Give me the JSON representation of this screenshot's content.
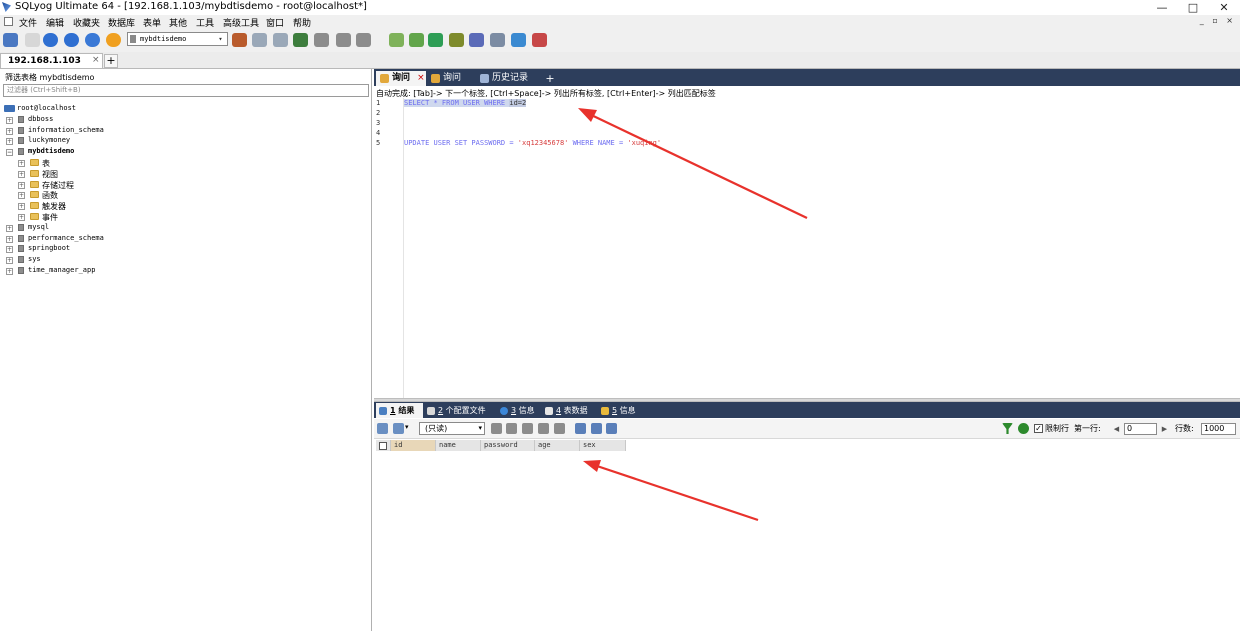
{
  "window": {
    "title": "SQLyog Ultimate 64 - [192.168.1.103/mybdtisdemo - root@localhost*]",
    "controls": [
      "—",
      "□",
      "✕"
    ],
    "mdi_controls": "_ ▫ ×"
  },
  "menu": [
    "文件",
    "编辑",
    "收藏夹",
    "数据库",
    "表单",
    "其他",
    "工具",
    "高级工具",
    "窗口",
    "帮助"
  ],
  "toolbar": {
    "database_select": "mybdtisdemo"
  },
  "connection_tab": {
    "label": "192.168.1.103",
    "close": "×",
    "new": "+"
  },
  "left": {
    "filter_label": "筛选表格 mybdtisdemo",
    "filter_placeholder": "过滤器 (Ctrl+Shift+B)",
    "tree": [
      {
        "label": "root@localhost",
        "level": 0,
        "kind": "server"
      },
      {
        "label": "dbboss",
        "level": 1,
        "kind": "db"
      },
      {
        "label": "information_schema",
        "level": 1,
        "kind": "db"
      },
      {
        "label": "luckymoney",
        "level": 1,
        "kind": "db"
      },
      {
        "label": "mybdtisdemo",
        "level": 1,
        "kind": "db",
        "expanded": true,
        "bold": true
      },
      {
        "label": "表",
        "level": 2,
        "kind": "folder"
      },
      {
        "label": "视图",
        "level": 2,
        "kind": "folder"
      },
      {
        "label": "存储过程",
        "level": 2,
        "kind": "folder"
      },
      {
        "label": "函数",
        "level": 2,
        "kind": "folder"
      },
      {
        "label": "触发器",
        "level": 2,
        "kind": "folder"
      },
      {
        "label": "事件",
        "level": 2,
        "kind": "folder"
      },
      {
        "label": "mysql",
        "level": 1,
        "kind": "db"
      },
      {
        "label": "performance_schema",
        "level": 1,
        "kind": "db"
      },
      {
        "label": "springboot",
        "level": 1,
        "kind": "db"
      },
      {
        "label": "sys",
        "level": 1,
        "kind": "db"
      },
      {
        "label": "time_manager_app",
        "level": 1,
        "kind": "db"
      }
    ]
  },
  "query_tabs": [
    {
      "label": "询问",
      "active": true,
      "close": "×"
    },
    {
      "label": "询问",
      "active": false
    },
    {
      "label": "历史记录",
      "active": false
    }
  ],
  "query_tab_add": "+",
  "autocomplete_hint": "自动完成: [Tab]-> 下一个标签, [Ctrl+Space]-> 列出所有标签, [Ctrl+Enter]-> 列出匹配标签",
  "editor": {
    "line_numbers": [
      "1",
      "2",
      "3",
      "4",
      "5"
    ],
    "line1": {
      "pre": "SELECT * FROM USER WHERE ",
      "sel": "id=2"
    },
    "line5": {
      "kw": "UPDATE USER SET PASSWORD = ",
      "s1": "'xq12345678'",
      "mid": " WHERE NAME = ",
      "s2": "'xuqing'"
    }
  },
  "result_tabs": [
    {
      "num": "1",
      "label": "结果",
      "active": true
    },
    {
      "num": "2",
      "label": "个配置文件"
    },
    {
      "num": "3",
      "label": "信息"
    },
    {
      "num": "4",
      "label": "表数据"
    },
    {
      "num": "5",
      "label": "信息"
    }
  ],
  "result_toolbar": {
    "mode": "(只读)",
    "limit_label": "限制行",
    "first_row_label": "第一行:",
    "first_row_value": "0",
    "rows_label": "行数:",
    "rows_value": "1000",
    "limit_checked": true
  },
  "grid": {
    "columns": [
      "id",
      "name",
      "password",
      "age",
      "sex"
    ]
  },
  "colors": {
    "tab_strip": "#2d3e5c",
    "arrow": "#e8322c",
    "selection": "#cfd8ee",
    "string": "#d63c3c",
    "keyword": "#6666cc"
  }
}
